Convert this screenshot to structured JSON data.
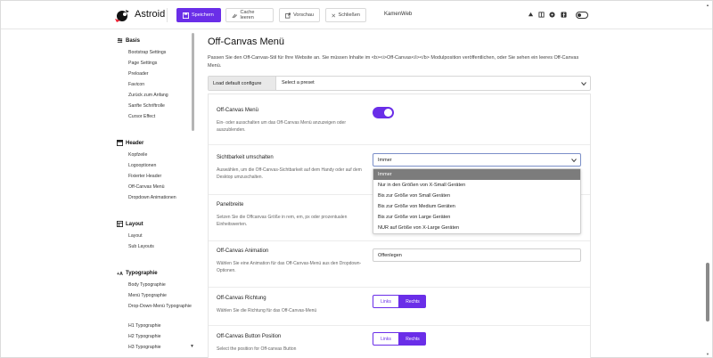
{
  "header": {
    "brand": "Astroid",
    "save_label": "Speichern",
    "clear_cache_label": "Cache leeren",
    "preview_label": "Vorschau",
    "close_label": "Schließen",
    "site_name": "KamenWeb",
    "accent_color": "#6a2ee8"
  },
  "sidebar": {
    "sections": [
      {
        "title": "Basis",
        "icon": "sliders-icon",
        "items": [
          "Bootstrap Settings",
          "Page Settings",
          "Preloader",
          "Favicon",
          "Zurück zum Anfang",
          "Sanfte Schriftrolle",
          "Cursor Effect"
        ]
      },
      {
        "title": "Header",
        "icon": "header-icon",
        "items": [
          "Kopfzeile",
          "Logooptionen",
          "Fixierter Header",
          "Off-Canvas Menü",
          "Dropdown Animationen"
        ]
      },
      {
        "title": "Layout",
        "icon": "layout-icon",
        "items": [
          "Layout",
          "Sub Layouts"
        ]
      },
      {
        "title": "Typographie",
        "icon": "typography-icon",
        "items": [
          "Body Typographie",
          "Menü Typographie",
          "Drop-Down-Menü Typographie",
          "H1 Typographie",
          "H2 Typographie",
          "H3 Typographie"
        ]
      }
    ]
  },
  "main": {
    "title": "Off-Canvas Menü",
    "description": "Passen Sie den Off-Canvas-Stil für Ihre Website an. Sie müssen Inhalte im <b><i>Off-Canvas</i></b> Modulposition veröffentlichen, oder Sie sehen ein leeres Off-Canvas Menü.",
    "preset": {
      "button": "Load default configure",
      "placeholder": "Select a preset"
    },
    "fields": {
      "offcanvas": {
        "label": "Off-Canvas Menü",
        "help": "Ein- oder ausschalten um das Off-Canvas Menü anzuzeigen oder auszublenden.",
        "enabled": true
      },
      "visibility": {
        "label": "Sichtbarkeit umschalten",
        "help": "Auswählen, um die Off-Canvas-Sichtbarkeit auf dem Handy oder auf dem Desktop umzuschalten.",
        "value": "Immer",
        "options": [
          "Immer",
          "Nur in den Größen von X-Small Geräten",
          "Bis zur Größe von Small Geräten",
          "Bis zur Größe von Medium Geräten",
          "Bis zur Größe von Large Geräten",
          "NUR auf Größe von X-Large Geräten"
        ]
      },
      "panel_width": {
        "label": "Panelbreite",
        "help": "Setzen Sie die Offcanvas Größe in rem, em, px oder prozentualen Einheitswerten."
      },
      "animation": {
        "label": "Off-Canvas Animation",
        "help": "Wählen Sie eine Animation für das Off-Canvas-Menü aus den Dropdown-Optionen.",
        "value": "Offenlegen"
      },
      "direction": {
        "label": "Off-Canvas Richtung",
        "help": "Wählen Sie die Richtung für das Off-Canvas-Menü",
        "left": "Links",
        "right": "Rechts",
        "selected": "Rechts"
      },
      "button_position": {
        "label": "Off-Canvas Button Position",
        "help": "Select the position for Off-canvas Button",
        "left": "Links",
        "right": "Rechts",
        "selected": "Rechts"
      }
    }
  }
}
